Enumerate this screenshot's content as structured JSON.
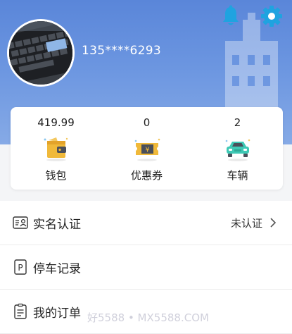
{
  "profile": {
    "phone": "135****6293"
  },
  "header": {
    "icons": [
      "bell-icon",
      "gear-icon"
    ],
    "accent_color": "#1e9bd7"
  },
  "stats": [
    {
      "value": "419.99",
      "label": "钱包",
      "icon": "wallet-icon"
    },
    {
      "value": "0",
      "label": "优惠券",
      "icon": "coupon-icon"
    },
    {
      "value": "2",
      "label": "车辆",
      "icon": "car-icon"
    }
  ],
  "menu": {
    "items": [
      {
        "label": "实名认证",
        "icon": "id-card-icon",
        "status": "未认证"
      },
      {
        "label": "停车记录",
        "icon": "parking-icon"
      },
      {
        "label": "我的订单",
        "icon": "order-list-icon"
      }
    ]
  },
  "watermark": "好5588 • MX5588.COM"
}
